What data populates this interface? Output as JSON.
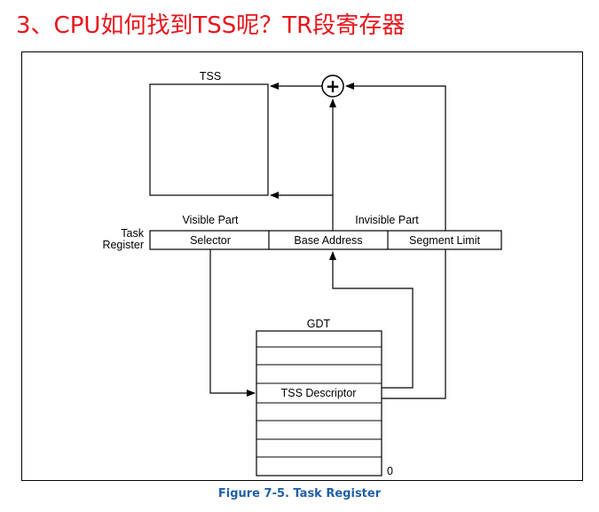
{
  "heading": "3、CPU如何找到TSS呢？TR段寄存器",
  "diagram": {
    "tss_label": "TSS",
    "plus_symbol": "+",
    "visible_part_label": "Visible Part",
    "invisible_part_label": "Invisible Part",
    "task_register_label_line1": "Task",
    "task_register_label_line2": "Register",
    "register_fields": [
      "Selector",
      "Base Address",
      "Segment Limit"
    ],
    "gdt_label": "GDT",
    "gdt_entry_label": "TSS Descriptor",
    "gdt_bottom_index": "0"
  },
  "caption": "Figure 7-5.  Task Register",
  "colors": {
    "heading": "#e8141b",
    "caption": "#1f5fa8",
    "lines": "#000000"
  }
}
